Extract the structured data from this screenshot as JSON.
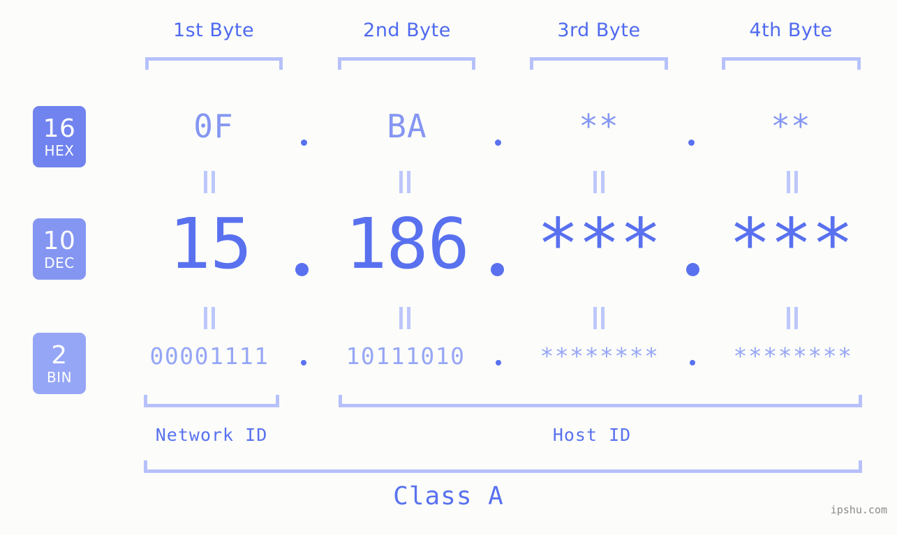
{
  "meta": {
    "watermark": "ipshu.com",
    "background_color": "#fcfdfa",
    "accent_color": "#5971ef",
    "bracket_color": "#b6c1fb"
  },
  "byte_headers": [
    {
      "label": "1st Byte"
    },
    {
      "label": "2nd Byte"
    },
    {
      "label": "3rd Byte"
    },
    {
      "label": "4th Byte"
    }
  ],
  "bases": [
    {
      "number": "16",
      "name": "HEX",
      "color": "#7183ee"
    },
    {
      "number": "10",
      "name": "DEC",
      "color": "#8596f2"
    },
    {
      "number": "2",
      "name": "BIN",
      "color": "#96a6f6"
    }
  ],
  "rows": {
    "hex": {
      "values": [
        "0F",
        "BA",
        "**",
        "**"
      ]
    },
    "dec": {
      "values": [
        "15",
        "186",
        "***",
        "***"
      ]
    },
    "bin": {
      "values": [
        "00001111",
        "10111010",
        "********",
        "********"
      ]
    }
  },
  "separators": {
    "hex": [
      ".",
      ".",
      "."
    ],
    "dec": [
      ".",
      ".",
      "."
    ],
    "bin": [
      ".",
      ".",
      "."
    ]
  },
  "equivalence": {
    "symbol": "=",
    "count_per_row": 4
  },
  "id_segments": [
    {
      "label": "Network ID"
    },
    {
      "label": "Host ID"
    }
  ],
  "class": {
    "label": "Class A"
  }
}
